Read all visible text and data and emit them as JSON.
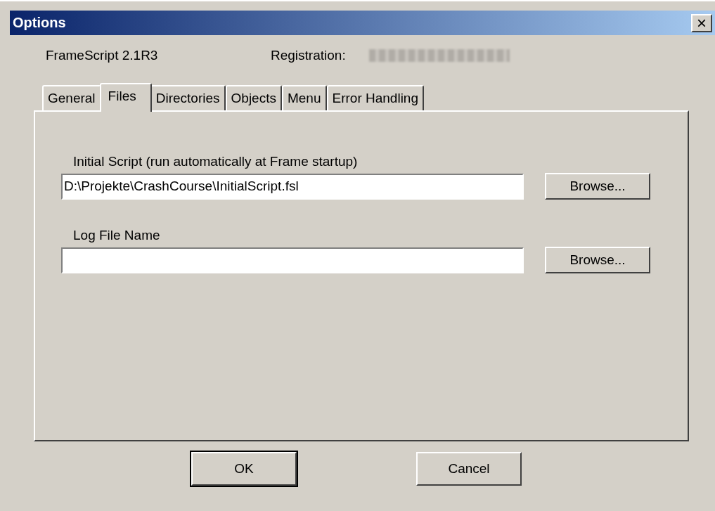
{
  "window": {
    "title": "Options",
    "close": "×"
  },
  "header": {
    "product": "FrameScript 2.1R3",
    "registration_label": "Registration:"
  },
  "tabs": [
    {
      "label": "General",
      "selected": false
    },
    {
      "label": "Files",
      "selected": true
    },
    {
      "label": "Directories",
      "selected": false
    },
    {
      "label": "Objects",
      "selected": false
    },
    {
      "label": "Menu",
      "selected": false
    },
    {
      "label": "Error Handling",
      "selected": false
    }
  ],
  "fields": [
    {
      "label": "Initial Script (run automatically at Frame startup)",
      "value": "D:\\Projekte\\CrashCourse\\InitialScript.fsl",
      "button": "Browse..."
    },
    {
      "label": "Log File Name",
      "button": "Browse..."
    }
  ],
  "buttons": [
    {
      "label": "OK",
      "default": true
    },
    {
      "label": "Cancel",
      "default": false
    }
  ]
}
